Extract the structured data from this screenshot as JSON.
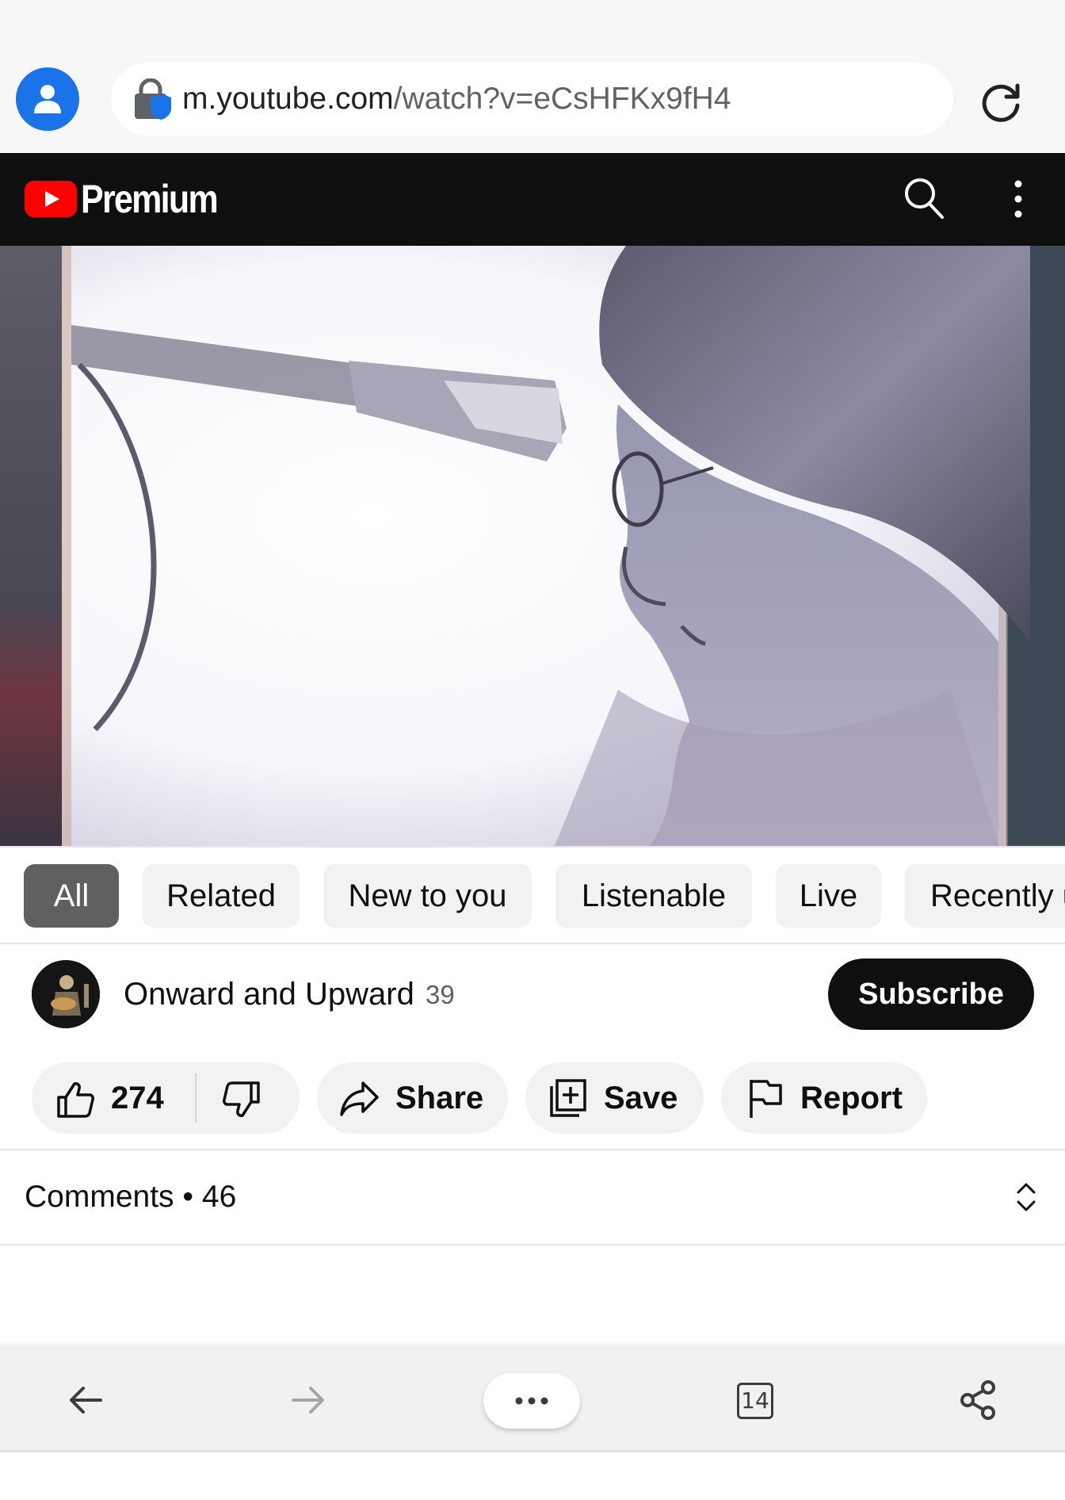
{
  "browser": {
    "url_domain": "m.youtube.com",
    "url_path": "/watch?v=eCsHFKx9fH4"
  },
  "header": {
    "brand": "Premium",
    "icons": [
      "youtube-logo-icon",
      "search-icon",
      "more-vert-icon"
    ]
  },
  "chips": [
    {
      "label": "All",
      "active": true
    },
    {
      "label": "Related",
      "active": false
    },
    {
      "label": "New to you",
      "active": false
    },
    {
      "label": "Listenable",
      "active": false
    },
    {
      "label": "Live",
      "active": false
    },
    {
      "label": "Recently uploaded",
      "active": false
    }
  ],
  "channel": {
    "name": "Onward and Upward",
    "subscriber_count": "39",
    "subscribe_label": "Subscribe"
  },
  "actions": {
    "like_count": "274",
    "share_label": "Share",
    "save_label": "Save",
    "report_label": "Report"
  },
  "comments": {
    "title": "Comments",
    "count": "46"
  },
  "bottom_bar": {
    "tab_count": "14",
    "icons": [
      "back-arrow-icon",
      "forward-arrow-icon",
      "more-horiz-icon",
      "tabs-icon",
      "share-icon"
    ]
  },
  "colors": {
    "youtube_red": "#ff0000",
    "header_bg": "#0f0f0f",
    "avatar_blue": "#1a73e8",
    "chip_active": "#606060",
    "chip_bg": "#f2f2f2"
  }
}
